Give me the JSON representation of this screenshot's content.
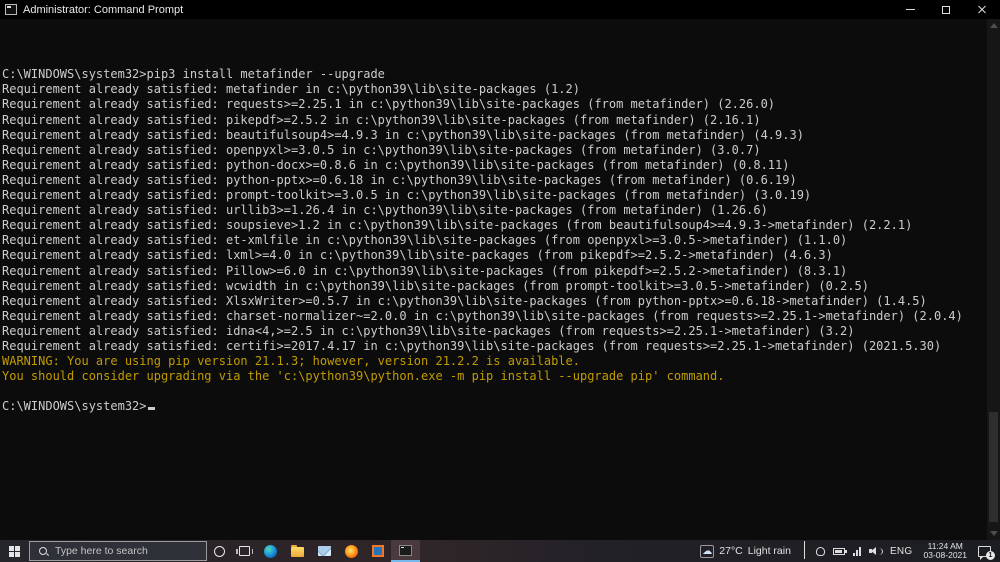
{
  "window": {
    "title": "Administrator: Command Prompt"
  },
  "terminal": {
    "colors": {
      "background": "#0c0c0c",
      "text": "#cccccc",
      "warning": "#c19c00"
    },
    "lines": [
      {
        "text": "C:\\WINDOWS\\system32>pip3 install metafinder --upgrade",
        "style": "normal"
      },
      {
        "text": "Requirement already satisfied: metafinder in c:\\python39\\lib\\site-packages (1.2)",
        "style": "normal"
      },
      {
        "text": "Requirement already satisfied: requests>=2.25.1 in c:\\python39\\lib\\site-packages (from metafinder) (2.26.0)",
        "style": "normal"
      },
      {
        "text": "Requirement already satisfied: pikepdf>=2.5.2 in c:\\python39\\lib\\site-packages (from metafinder) (2.16.1)",
        "style": "normal"
      },
      {
        "text": "Requirement already satisfied: beautifulsoup4>=4.9.3 in c:\\python39\\lib\\site-packages (from metafinder) (4.9.3)",
        "style": "normal"
      },
      {
        "text": "Requirement already satisfied: openpyxl>=3.0.5 in c:\\python39\\lib\\site-packages (from metafinder) (3.0.7)",
        "style": "normal"
      },
      {
        "text": "Requirement already satisfied: python-docx>=0.8.6 in c:\\python39\\lib\\site-packages (from metafinder) (0.8.11)",
        "style": "normal"
      },
      {
        "text": "Requirement already satisfied: python-pptx>=0.6.18 in c:\\python39\\lib\\site-packages (from metafinder) (0.6.19)",
        "style": "normal"
      },
      {
        "text": "Requirement already satisfied: prompt-toolkit>=3.0.5 in c:\\python39\\lib\\site-packages (from metafinder) (3.0.19)",
        "style": "normal"
      },
      {
        "text": "Requirement already satisfied: urllib3>=1.26.4 in c:\\python39\\lib\\site-packages (from metafinder) (1.26.6)",
        "style": "normal"
      },
      {
        "text": "Requirement already satisfied: soupsieve>1.2 in c:\\python39\\lib\\site-packages (from beautifulsoup4>=4.9.3->metafinder) (2.2.1)",
        "style": "normal"
      },
      {
        "text": "Requirement already satisfied: et-xmlfile in c:\\python39\\lib\\site-packages (from openpyxl>=3.0.5->metafinder) (1.1.0)",
        "style": "normal"
      },
      {
        "text": "Requirement already satisfied: lxml>=4.0 in c:\\python39\\lib\\site-packages (from pikepdf>=2.5.2->metafinder) (4.6.3)",
        "style": "normal"
      },
      {
        "text": "Requirement already satisfied: Pillow>=6.0 in c:\\python39\\lib\\site-packages (from pikepdf>=2.5.2->metafinder) (8.3.1)",
        "style": "normal"
      },
      {
        "text": "Requirement already satisfied: wcwidth in c:\\python39\\lib\\site-packages (from prompt-toolkit>=3.0.5->metafinder) (0.2.5)",
        "style": "normal"
      },
      {
        "text": "Requirement already satisfied: XlsxWriter>=0.5.7 in c:\\python39\\lib\\site-packages (from python-pptx>=0.6.18->metafinder) (1.4.5)",
        "style": "normal"
      },
      {
        "text": "Requirement already satisfied: charset-normalizer~=2.0.0 in c:\\python39\\lib\\site-packages (from requests>=2.25.1->metafinder) (2.0.4)",
        "style": "normal"
      },
      {
        "text": "Requirement already satisfied: idna<4,>=2.5 in c:\\python39\\lib\\site-packages (from requests>=2.25.1->metafinder) (3.2)",
        "style": "normal"
      },
      {
        "text": "Requirement already satisfied: certifi>=2017.4.17 in c:\\python39\\lib\\site-packages (from requests>=2.25.1->metafinder) (2021.5.30)",
        "style": "normal"
      },
      {
        "text": "WARNING: You are using pip version 21.1.3; however, version 21.2.2 is available.",
        "style": "warning"
      },
      {
        "text": "You should consider upgrading via the 'c:\\python39\\python.exe -m pip install --upgrade pip' command.",
        "style": "warning"
      },
      {
        "text": "",
        "style": "normal"
      }
    ],
    "prompt": "C:\\WINDOWS\\system32>"
  },
  "taskbar": {
    "search": {
      "placeholder": "Type here to search"
    },
    "tray": {
      "weather_glyph": "☁",
      "temperature": "27°C",
      "condition": "Light rain",
      "language": "ENG",
      "time": "11:24 AM",
      "date": "03-08-2021",
      "notification_count": "1"
    }
  }
}
